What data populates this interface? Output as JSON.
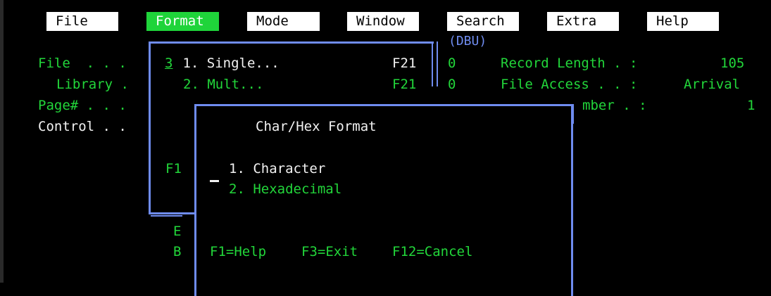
{
  "menubar": [
    {
      "label": "File",
      "active": false
    },
    {
      "label": "Format",
      "active": true
    },
    {
      "label": "Mode",
      "active": false
    },
    {
      "label": "Window",
      "active": false
    },
    {
      "label": "Search",
      "active": false
    },
    {
      "label": "Extra",
      "active": false
    },
    {
      "label": "Help",
      "active": false
    }
  ],
  "background": {
    "dbu": "(DBU)",
    "file_label": "File  . . .",
    "library_label": "Library .",
    "page_label": "Page# . . .",
    "control_label": "Control . .",
    "val1": "0",
    "val2": "0",
    "record_length_label": "Record Length . :",
    "record_length_value": "105",
    "file_access_label": "File Access . . :",
    "file_access_value": "Arrival",
    "number_label": "mber . :",
    "number_value": "1"
  },
  "format_menu": {
    "selection": "3",
    "item1_label": " 1. Single...",
    "item1_key": "F21",
    "item2_label": "2. Mult...",
    "item2_key": "F21",
    "partial_f1": "F1",
    "partial_e": "E",
    "partial_b": "B"
  },
  "dialog": {
    "title": "Char/Hex Format",
    "option1": "1. Character",
    "option2": "2. Hexadecimal",
    "f1": "F1=Help",
    "f3": "F3=Exit",
    "f12": "F12=Cancel"
  },
  "colors": {
    "green": "#22d63a",
    "white": "#f2f2f2",
    "blue": "#6f8cf0",
    "active_menu": "#1fd43a"
  }
}
